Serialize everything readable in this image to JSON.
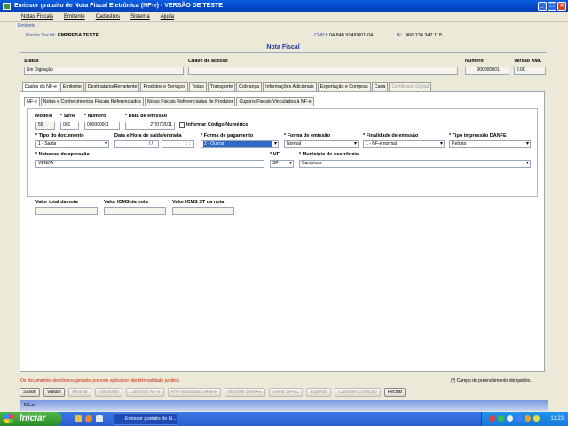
{
  "window": {
    "title": "Emissor gratuito de Nota Fiscal Eletrônica (NF-e) - VERSÃO DE TESTE"
  },
  "menu": [
    "Notas Fiscais",
    "Emitente",
    "Cadastros",
    "Sistema",
    "Ajuda"
  ],
  "emitente": {
    "section_label": "Emitente",
    "razao_label": "Razão Social:",
    "razao_value": "EMPRESA TESTE",
    "cnpj_label": "CNPJ:",
    "cnpj_value": "04.848.914/0001-04",
    "ie_label": "IE:",
    "ie_value": "466.136.347.118"
  },
  "nota": {
    "heading": "Nota Fiscal",
    "status_label": "Status",
    "status_value": "Em Digitação",
    "chave_label": "Chave de acesso",
    "chave_value": "",
    "numero_label": "Número",
    "numero_value": "000000001",
    "versao_label": "Versão XML",
    "versao_value": "2.00"
  },
  "main_tabs": [
    "Dados da NF-e",
    "Emitente",
    "Destinatário/Remetente",
    "Produtos e Serviços",
    "Totais",
    "Transporte",
    "Cobrança",
    "Informações Adicionais",
    "Exportação e Compras",
    "Cana",
    "Certificado Digital"
  ],
  "sub_tabs": [
    "NF-e",
    "Notas e Conhecimentos Fiscais Referenciados",
    "Notas Fiscais Referenciadas de Produtor",
    "Cupons Fiscais Vinculados à NF-e"
  ],
  "form": {
    "modelo_label": "Modelo",
    "modelo_value": "55",
    "serie_label": "* Série",
    "serie_value": "001",
    "numero_label": "* Número",
    "numero_value": "000000001",
    "data_emissao_label": "* Data de emissão",
    "data_emissao_value": "27/07/2011",
    "codigo_numerico_label": "Informar Código Numérico",
    "tipo_doc_label": "* Tipo do documento",
    "tipo_doc_value": "1 - Saída",
    "data_saida_label": "Data e Hora de saída/entrada",
    "data_saida_value": "/ /",
    "hora_saida_value": ":  :",
    "forma_pag_label": "* Forma de pagamento",
    "forma_pag_value": "2 - Outros",
    "forma_emissao_label": "* Forma de emissão",
    "forma_emissao_value": "Normal",
    "finalidade_label": "* Finalidade de emissão",
    "finalidade_value": "1 - NF-e normal",
    "tipo_impressao_label": "* Tipo impressão DANFE",
    "tipo_impressao_value": "Retrato",
    "natureza_label": "* Natureza da operação",
    "natureza_value": "VENDA",
    "uf_label": "* UF",
    "uf_value": "SP",
    "municipio_label": "* Município de ocorrência",
    "municipio_value": "Campinas"
  },
  "totais": {
    "valor_total_label": "Valor total da nota",
    "valor_icms_label": "Valor ICMS da nota",
    "valor_icms_st_label": "Valor ICMS ST da nota"
  },
  "notes": {
    "warning": "Os documentos eletrônicos gerados por este aplicativo não têm validade jurídica",
    "required": "Campo de preenchimento obrigatório."
  },
  "buttons": [
    {
      "label": "Salvar",
      "enabled": true
    },
    {
      "label": "Validar",
      "enabled": true
    },
    {
      "label": "Assinar",
      "enabled": false
    },
    {
      "label": "Transmitir",
      "enabled": false
    },
    {
      "label": "Cancelar NF-e",
      "enabled": false
    },
    {
      "label": "Pré-Visualizar DANFE",
      "enabled": false
    },
    {
      "label": "Imprimir DANFE",
      "enabled": false
    },
    {
      "label": "Gerar DPEC",
      "enabled": false
    },
    {
      "label": "Exportar",
      "enabled": false
    },
    {
      "label": "Carta de Correção",
      "enabled": false
    },
    {
      "label": "Fechar",
      "enabled": true
    }
  ],
  "statusbar": {
    "text": "NF-e"
  },
  "taskbar": {
    "start": "Iniciar",
    "task": "Emissor gratuito de N...",
    "clock": "11:23"
  },
  "colors": {
    "title_blue": "#0548c8",
    "heading_blue": "#1c3c9c",
    "selected_blue": "#316ac5",
    "warning_red": "#cc2200"
  }
}
